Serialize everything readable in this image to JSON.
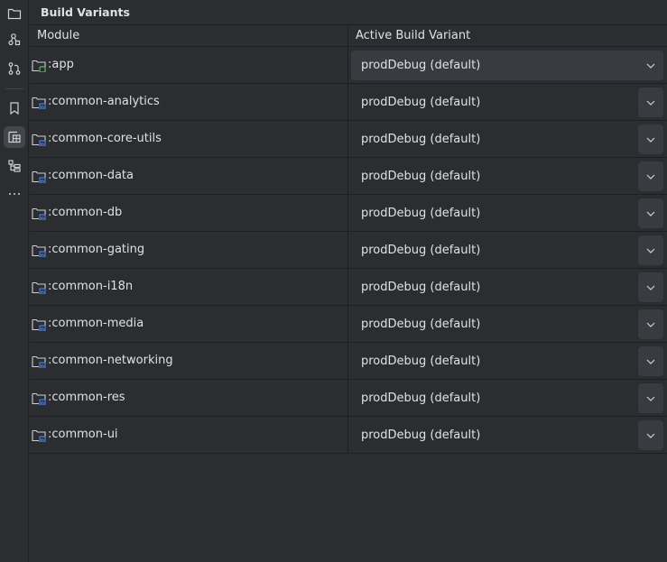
{
  "panel": {
    "title": "Build Variants"
  },
  "table": {
    "headers": {
      "module": "Module",
      "variant": "Active Build Variant"
    },
    "rows": [
      {
        "module": ":app",
        "variant": "prodDebug (default)",
        "type": "app"
      },
      {
        "module": ":common-analytics",
        "variant": "prodDebug (default)",
        "type": "library"
      },
      {
        "module": ":common-core-utils",
        "variant": "prodDebug (default)",
        "type": "library"
      },
      {
        "module": ":common-data",
        "variant": "prodDebug (default)",
        "type": "library"
      },
      {
        "module": ":common-db",
        "variant": "prodDebug (default)",
        "type": "library"
      },
      {
        "module": ":common-gating",
        "variant": "prodDebug (default)",
        "type": "library"
      },
      {
        "module": ":common-i18n",
        "variant": "prodDebug (default)",
        "type": "library"
      },
      {
        "module": ":common-media",
        "variant": "prodDebug (default)",
        "type": "library"
      },
      {
        "module": ":common-networking",
        "variant": "prodDebug (default)",
        "type": "library"
      },
      {
        "module": ":common-res",
        "variant": "prodDebug (default)",
        "type": "library"
      },
      {
        "module": ":common-ui",
        "variant": "prodDebug (default)",
        "type": "library"
      }
    ]
  },
  "sidebar": {
    "tools": [
      {
        "icon": "folder-icon"
      },
      {
        "icon": "structure-icon"
      },
      {
        "icon": "git-branch-icon"
      },
      {
        "icon": "bookmark-icon"
      },
      {
        "icon": "build-variants-icon",
        "active": true
      },
      {
        "icon": "hierarchy-icon"
      },
      {
        "icon": "more-icon"
      }
    ]
  },
  "colors": {
    "background": "#2b2d30",
    "border": "#1e1f22",
    "cell": "#393b40",
    "text": "#dfe1e5",
    "app_badge": "#5fb865",
    "library_badge": "#548af7"
  }
}
